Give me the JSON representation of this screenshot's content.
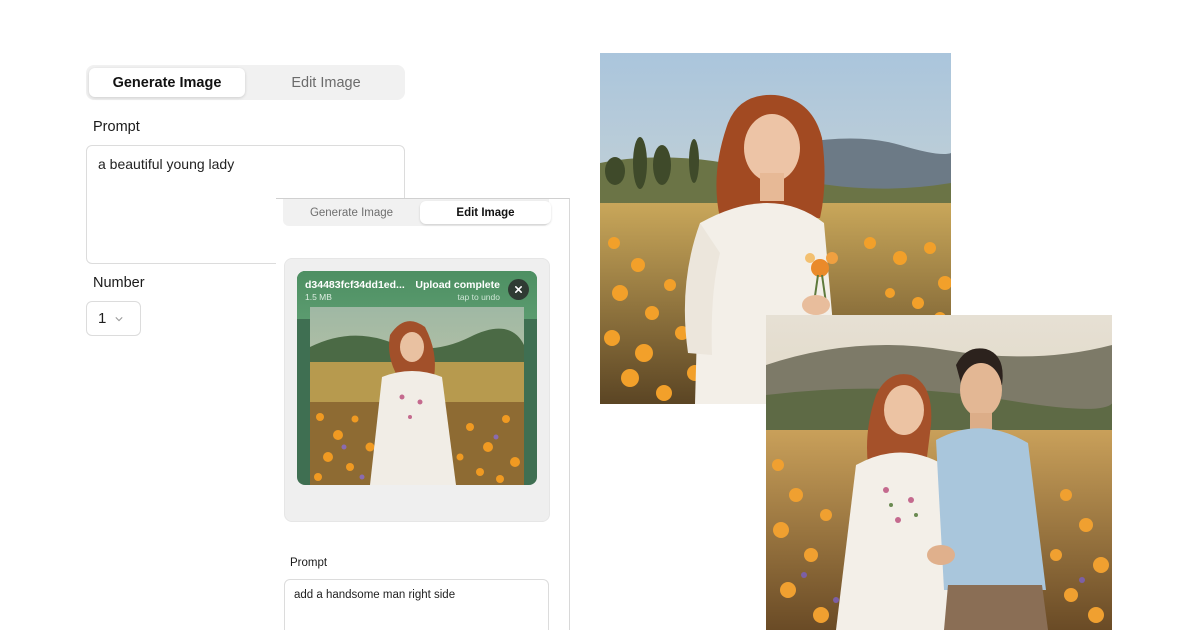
{
  "generate_panel": {
    "tabs": [
      {
        "label": "Generate Image",
        "active": true
      },
      {
        "label": "Edit Image",
        "active": false
      }
    ],
    "prompt_label": "Prompt",
    "prompt_value": "a beautiful young lady",
    "number_label": "Number",
    "number_value": "1"
  },
  "edit_panel": {
    "tabs": [
      {
        "label": "Generate Image",
        "active": false
      },
      {
        "label": "Edit Image",
        "active": true
      }
    ],
    "file": {
      "name": "d34483fcf34dd1ed...",
      "size": "1.5 MB",
      "status": "Upload complete",
      "undo_hint": "tap to undo"
    },
    "prompt_label": "Prompt",
    "prompt_value": "add a handsome man right side"
  },
  "results": [
    {
      "icon": "portrait-woman-in-flower-field-photo"
    },
    {
      "icon": "couple-in-flower-field-photo"
    }
  ],
  "colors": {
    "upload_header": "#5b9b6f",
    "flowers": "#e8902a",
    "sky": "#bcd4e6"
  }
}
